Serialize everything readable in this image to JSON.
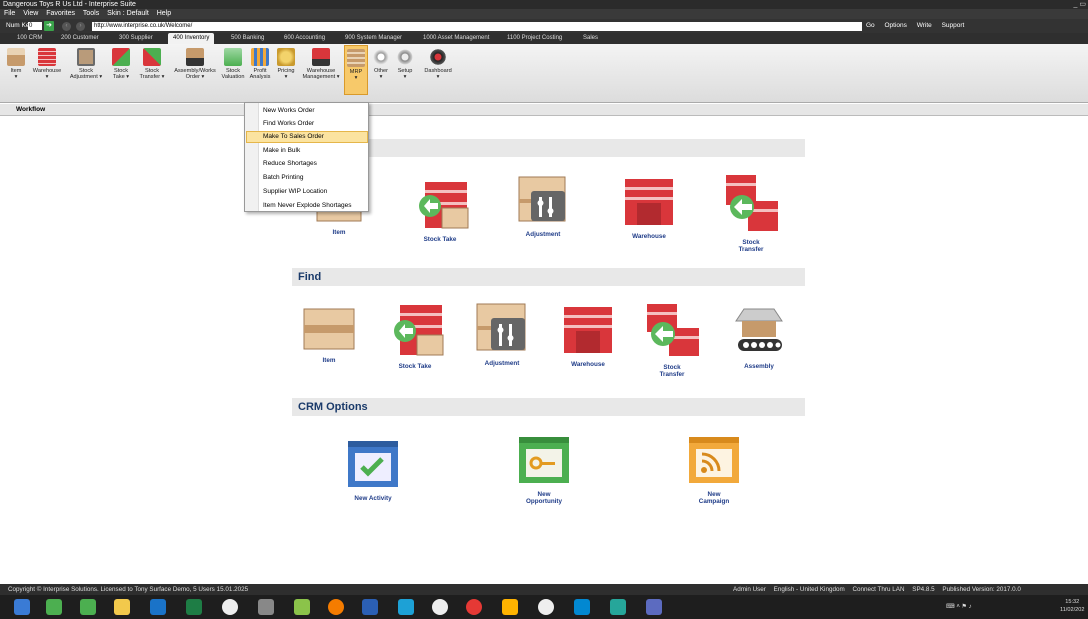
{
  "window": {
    "title": "Dangerous Toys R Us Ltd - Interprise Suite",
    "controls": "_ ▭"
  },
  "menu": [
    "File",
    "View",
    "Favorites",
    "Tools",
    "Skin : Default",
    "Help"
  ],
  "address": {
    "numkey_label": "Num Key",
    "numkey_value": "0",
    "url": "http://www.interprise.co.uk/Welcome/",
    "right_items": [
      "Go",
      "Options",
      "Write",
      "Support"
    ]
  },
  "modules": [
    "100 CRM",
    "200 Customer",
    "300 Supplier",
    "400 Inventory",
    "500 Banking",
    "600 Accounting",
    "900 System Manager",
    "1000 Asset Management",
    "1100 Project Costing",
    "Sales"
  ],
  "active_module": "400 Inventory",
  "ribbon": [
    {
      "l1": "Item",
      "l2": "▾",
      "icon": "item-icon"
    },
    {
      "l1": "Warehouse",
      "l2": "▾",
      "icon": "warehouse-icon"
    },
    {
      "l1": "Stock",
      "l2": "Adjustment ▾",
      "icon": "stock-adjustment-icon"
    },
    {
      "l1": "Stock",
      "l2": "Take ▾",
      "icon": "stock-take-icon"
    },
    {
      "l1": "Stock",
      "l2": "Transfer ▾",
      "icon": "stock-transfer-icon"
    },
    {
      "l1": "Assembly/Works",
      "l2": "Order ▾",
      "icon": "assembly-icon"
    },
    {
      "l1": "Stock",
      "l2": "Valuation",
      "icon": "stock-valuation-icon"
    },
    {
      "l1": "Profit",
      "l2": "Analysis",
      "icon": "profit-analysis-icon"
    },
    {
      "l1": "Pricing",
      "l2": "▾",
      "icon": "pricing-icon"
    },
    {
      "l1": "Warehouse",
      "l2": "Management ▾",
      "icon": "warehouse-management-icon"
    },
    {
      "l1": "MRP",
      "l2": "▾",
      "icon": "mrp-icon"
    },
    {
      "l1": "Other",
      "l2": "▾",
      "icon": "other-icon"
    },
    {
      "l1": "Setup",
      "l2": "▾",
      "icon": "setup-icon"
    },
    {
      "l1": "Dashboard",
      "l2": "▾",
      "icon": "dashboard-icon"
    }
  ],
  "workflow_label": "Workflow",
  "mrp_menu": [
    "New Works Order",
    "Find Works Order",
    "Make To Sales Order",
    "Make in Bulk",
    "Reduce Shortages",
    "Batch Printing",
    "Supplier WIP Location",
    "Item Never Explode Shortages"
  ],
  "mrp_menu_highlighted": "Make To Sales Order",
  "sections": {
    "new": {
      "items": [
        "Item",
        "Stock Take",
        "Adjustment",
        "Warehouse",
        "Stock\nTransfer"
      ]
    },
    "find": {
      "title": "Find",
      "items": [
        "Item",
        "Stock Take",
        "Adjustment",
        "Warehouse",
        "Stock\nTransfer",
        "Assembly"
      ]
    },
    "crm": {
      "title": "CRM Options",
      "items": [
        "New Activity",
        "New\nOpportunity",
        "New\nCampaign"
      ]
    }
  },
  "status": {
    "copyright": "Copyright © Interprise Solutions. Licensed to Tony Surface Demo, 5 Users 15.01.2025",
    "user": "Admin User",
    "language": "English - United Kingdom",
    "connection": "Connect Thru LAN",
    "sp": "SP4.8.5",
    "version": "Published Version: 2017.0.0"
  },
  "clock": {
    "time": "15:32",
    "date": "11/02/202"
  },
  "colors": {
    "accent": "#f7c96a",
    "link": "#1f3c88",
    "brick": "#d9363b"
  }
}
